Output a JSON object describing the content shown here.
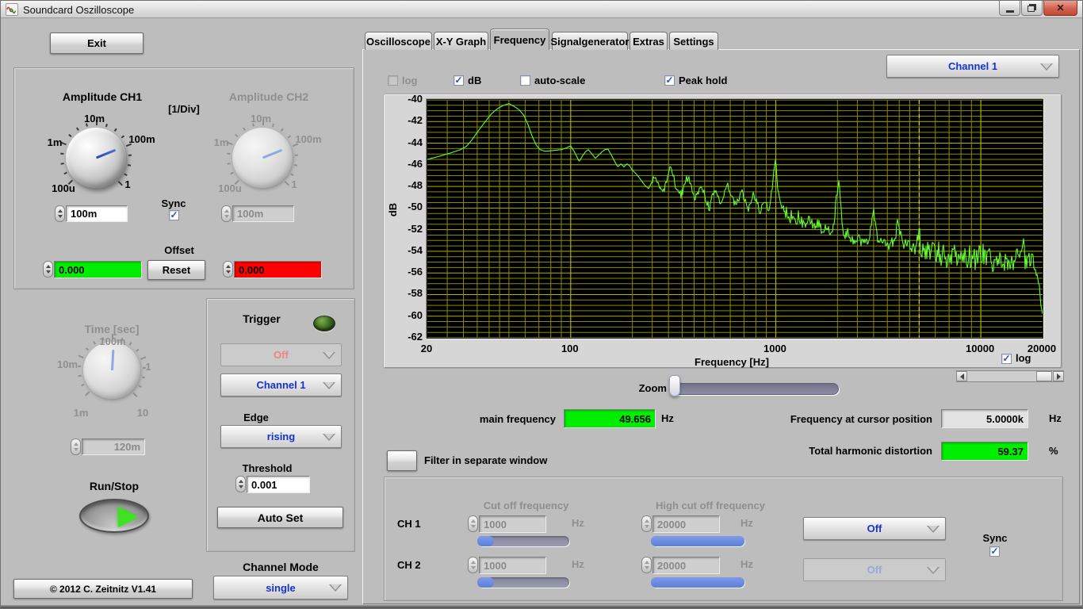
{
  "titlebar": {
    "title": "Soundcard Oszilloscope"
  },
  "left": {
    "exit": "Exit",
    "amp": {
      "ch1_title": "Amplitude CH1",
      "unit": "[1/Div]",
      "ch2_title": "Amplitude CH2",
      "ticks": [
        "100u",
        "1m",
        "10m",
        "100m",
        "1"
      ],
      "ch1_value": "100m",
      "ch2_value": "100m",
      "sync": "Sync",
      "sync_checked": true,
      "offset": "Offset",
      "reset": "Reset",
      "ch1_offset": "0.000",
      "ch2_offset": "0.000",
      "ch1_offset_color": "#00ef00",
      "ch2_offset_color": "#ff0000"
    },
    "time": {
      "title": "Time [sec]",
      "ticks": [
        "1m",
        "10m",
        "100m",
        "1",
        "10"
      ],
      "value": "120m"
    },
    "run_stop": "Run/Stop",
    "copyright": "© 2012   C. Zeitnitz V1.41"
  },
  "trigger": {
    "title": "Trigger",
    "mode": "Off",
    "source": "Channel 1",
    "edge_label": "Edge",
    "edge": "rising",
    "threshold_label": "Threshold",
    "threshold": "0.001",
    "auto_set": "Auto Set"
  },
  "channel_mode": {
    "label": "Channel Mode",
    "value": "single"
  },
  "tabs": {
    "items": [
      "Oscilloscope",
      "X-Y Graph",
      "Frequency",
      "Signalgenerator",
      "Extras",
      "Settings"
    ],
    "active": "Frequency"
  },
  "freq": {
    "log": "log",
    "log_checked": false,
    "db": "dB",
    "db_checked": true,
    "autoscale": "auto-scale",
    "autoscale_checked": false,
    "peak_hold": "Peak hold",
    "peak_hold_checked": true,
    "channel": "Channel 1",
    "axis_log": "log",
    "axis_log_checked": true,
    "zoom": "Zoom",
    "main_freq": {
      "label": "main frequency",
      "value": "49.656",
      "unit": "Hz"
    },
    "cursor_freq": {
      "label": "Frequency at cursor position",
      "value": "5.0000k",
      "unit": "Hz"
    },
    "thd": {
      "label": "Total harmonic distortion",
      "value": "59.37",
      "unit": "%"
    },
    "filter_window": "Filter in separate window",
    "filter": {
      "ch1": "CH 1",
      "ch2": "CH 2",
      "cutoff": "Cut off frequency",
      "high_cutoff": "High cut off frequency",
      "hz": "Hz",
      "ch1_cutoff": "1000",
      "ch2_cutoff": "1000",
      "ch1_high": "20000",
      "ch2_high": "20000",
      "ch1_mode": "Off",
      "ch2_mode": "Off",
      "sync": "Sync",
      "sync_checked": true
    }
  },
  "chart_data": {
    "type": "line",
    "title": "",
    "xlabel": "Frequency [Hz]",
    "ylabel": "dB",
    "xscale": "log",
    "xlim": [
      20,
      20000
    ],
    "ylim": [
      -62,
      -40
    ],
    "x_ticks": [
      20,
      100,
      1000,
      10000,
      20000
    ],
    "x_major": [
      100,
      1000,
      10000
    ],
    "y_ticks": [
      -40,
      -42,
      -44,
      -46,
      -48,
      -50,
      -52,
      -54,
      -56,
      -58,
      -60,
      -62
    ],
    "y_minor_step": 0.5,
    "cursor_hz": 5000,
    "main_frequency_hz": 49.656,
    "thd_percent": 59.37,
    "grid": true,
    "colors": {
      "trace": "#5fff2e",
      "grid": "#8a8a00",
      "grid_major": "#b0b000",
      "cursor": "#dede5a",
      "plot_bg": "#000000"
    },
    "seed": 123456789,
    "jitter_regions": [
      [
        250,
        1000,
        0.35
      ],
      [
        1000,
        5000,
        0.5
      ],
      [
        5000,
        19000,
        0.95
      ],
      [
        19000,
        20000,
        0.6
      ]
    ],
    "points": [
      [
        20,
        -45.5
      ],
      [
        23,
        -45.2
      ],
      [
        26,
        -44.9
      ],
      [
        29,
        -44.6
      ],
      [
        31,
        -44.3
      ],
      [
        33,
        -43.7
      ],
      [
        35,
        -43.0
      ],
      [
        38,
        -42.1
      ],
      [
        41,
        -41.3
      ],
      [
        44,
        -40.8
      ],
      [
        47,
        -40.5
      ],
      [
        50,
        -40.35
      ],
      [
        53,
        -40.6
      ],
      [
        56,
        -40.9
      ],
      [
        59,
        -41.4
      ],
      [
        62,
        -42.3
      ],
      [
        65,
        -43.4
      ],
      [
        68,
        -44.2
      ],
      [
        71,
        -44.6
      ],
      [
        75,
        -44.75
      ],
      [
        80,
        -44.7
      ],
      [
        85,
        -44.65
      ],
      [
        90,
        -44.6
      ],
      [
        95,
        -44.45
      ],
      [
        100,
        -44.25
      ],
      [
        105,
        -44.9
      ],
      [
        110,
        -45.7
      ],
      [
        114,
        -45.2
      ],
      [
        118,
        -44.8
      ],
      [
        122,
        -44.6
      ],
      [
        127,
        -45.0
      ],
      [
        132,
        -45.4
      ],
      [
        137,
        -45.1
      ],
      [
        142,
        -44.8
      ],
      [
        147,
        -44.6
      ],
      [
        152,
        -44.55
      ],
      [
        158,
        -45.1
      ],
      [
        164,
        -45.7
      ],
      [
        170,
        -46.2
      ],
      [
        176,
        -45.9
      ],
      [
        182,
        -46.2
      ],
      [
        188,
        -45.9
      ],
      [
        194,
        -46.1
      ],
      [
        200,
        -46.5
      ],
      [
        210,
        -46.9
      ],
      [
        220,
        -47.4
      ],
      [
        230,
        -47.9
      ],
      [
        240,
        -48.2
      ],
      [
        250,
        -47.5
      ],
      [
        258,
        -47.1
      ],
      [
        266,
        -47.6
      ],
      [
        275,
        -48.1
      ],
      [
        285,
        -48.4
      ],
      [
        295,
        -47.6
      ],
      [
        305,
        -46.1
      ],
      [
        315,
        -46.9
      ],
      [
        325,
        -47.9
      ],
      [
        335,
        -48.5
      ],
      [
        345,
        -48.8
      ],
      [
        355,
        -48.2
      ],
      [
        365,
        -47.4
      ],
      [
        375,
        -47.1
      ],
      [
        385,
        -47.9
      ],
      [
        395,
        -48.6
      ],
      [
        405,
        -49.2
      ],
      [
        415,
        -48.7
      ],
      [
        425,
        -48.1
      ],
      [
        435,
        -47.9
      ],
      [
        445,
        -48.5
      ],
      [
        455,
        -49.1
      ],
      [
        465,
        -49.6
      ],
      [
        475,
        -50.0
      ],
      [
        485,
        -49.3
      ],
      [
        495,
        -48.7
      ],
      [
        505,
        -48.2
      ],
      [
        520,
        -48.9
      ],
      [
        540,
        -49.5
      ],
      [
        560,
        -48.7
      ],
      [
        580,
        -47.9
      ],
      [
        600,
        -48.4
      ],
      [
        620,
        -49.2
      ],
      [
        640,
        -49.8
      ],
      [
        660,
        -49.1
      ],
      [
        680,
        -48.5
      ],
      [
        700,
        -49.0
      ],
      [
        720,
        -49.6
      ],
      [
        740,
        -50.1
      ],
      [
        760,
        -49.3
      ],
      [
        780,
        -48.7
      ],
      [
        800,
        -49.1
      ],
      [
        820,
        -49.8
      ],
      [
        840,
        -50.3
      ],
      [
        860,
        -49.8
      ],
      [
        880,
        -49.2
      ],
      [
        900,
        -49.7
      ],
      [
        920,
        -50.2
      ],
      [
        940,
        -49.4
      ],
      [
        960,
        -48.2
      ],
      [
        980,
        -46.5
      ],
      [
        1000,
        -45.7
      ],
      [
        1015,
        -47.2
      ],
      [
        1030,
        -48.6
      ],
      [
        1050,
        -49.7
      ],
      [
        1070,
        -50.4
      ],
      [
        1090,
        -49.9
      ],
      [
        1110,
        -50.7
      ],
      [
        1130,
        -50.2
      ],
      [
        1150,
        -50.8
      ],
      [
        1170,
        -51.2
      ],
      [
        1190,
        -50.6
      ],
      [
        1210,
        -51.0
      ],
      [
        1250,
        -51.4
      ],
      [
        1290,
        -50.7
      ],
      [
        1330,
        -51.2
      ],
      [
        1370,
        -51.7
      ],
      [
        1410,
        -51.1
      ],
      [
        1450,
        -50.7
      ],
      [
        1500,
        -51.4
      ],
      [
        1550,
        -51.9
      ],
      [
        1600,
        -51.3
      ],
      [
        1650,
        -51.8
      ],
      [
        1700,
        -52.2
      ],
      [
        1750,
        -51.6
      ],
      [
        1800,
        -52.0
      ],
      [
        1850,
        -52.4
      ],
      [
        1900,
        -51.8
      ],
      [
        1950,
        -50.2
      ],
      [
        2000,
        -48.1
      ],
      [
        2040,
        -47.3
      ],
      [
        2080,
        -49.6
      ],
      [
        2120,
        -51.8
      ],
      [
        2160,
        -52.5
      ],
      [
        2220,
        -52.2
      ],
      [
        2300,
        -52.6
      ],
      [
        2400,
        -53.0
      ],
      [
        2500,
        -52.6
      ],
      [
        2600,
        -53.1
      ],
      [
        2700,
        -52.8
      ],
      [
        2800,
        -53.3
      ],
      [
        2900,
        -51.9
      ],
      [
        3000,
        -49.9
      ],
      [
        3080,
        -51.8
      ],
      [
        3160,
        -53.2
      ],
      [
        3250,
        -52.7
      ],
      [
        3350,
        -53.4
      ],
      [
        3450,
        -53.0
      ],
      [
        3550,
        -53.5
      ],
      [
        3650,
        -52.9
      ],
      [
        3750,
        -53.3
      ],
      [
        3850,
        -52.4
      ],
      [
        3950,
        -51.1
      ],
      [
        4050,
        -52.3
      ],
      [
        4150,
        -53.5
      ],
      [
        4250,
        -53.1
      ],
      [
        4350,
        -53.7
      ],
      [
        4450,
        -53.2
      ],
      [
        4550,
        -53.8
      ],
      [
        4650,
        -53.3
      ],
      [
        4750,
        -53.9
      ],
      [
        4850,
        -53.4
      ],
      [
        4950,
        -52.6
      ],
      [
        5000,
        -52.2
      ],
      [
        5100,
        -53.5
      ],
      [
        5250,
        -53.9
      ],
      [
        5400,
        -54.2
      ],
      [
        5550,
        -53.7
      ],
      [
        5700,
        -54.3
      ],
      [
        5850,
        -53.9
      ],
      [
        6000,
        -54.4
      ],
      [
        6200,
        -53.8
      ],
      [
        6400,
        -54.5
      ],
      [
        6600,
        -54.0
      ],
      [
        6800,
        -54.6
      ],
      [
        7000,
        -54.1
      ],
      [
        7200,
        -54.6
      ],
      [
        7400,
        -54.0
      ],
      [
        7600,
        -54.7
      ],
      [
        7800,
        -54.2
      ],
      [
        8000,
        -53.8
      ],
      [
        8200,
        -54.6
      ],
      [
        8400,
        -54.1
      ],
      [
        8600,
        -54.8
      ],
      [
        8800,
        -54.3
      ],
      [
        9000,
        -54.9
      ],
      [
        9200,
        -54.4
      ],
      [
        9400,
        -55.0
      ],
      [
        9600,
        -54.5
      ],
      [
        9800,
        -54.1
      ],
      [
        10000,
        -54.6
      ],
      [
        10300,
        -54.2
      ],
      [
        10600,
        -54.9
      ],
      [
        11000,
        -54.4
      ],
      [
        11400,
        -55.1
      ],
      [
        11800,
        -54.6
      ],
      [
        12200,
        -55.2
      ],
      [
        12600,
        -54.7
      ],
      [
        13000,
        -55.3
      ],
      [
        13400,
        -54.8
      ],
      [
        13800,
        -55.4
      ],
      [
        14200,
        -54.9
      ],
      [
        14600,
        -55.3
      ],
      [
        15000,
        -54.5
      ],
      [
        15400,
        -55.1
      ],
      [
        15800,
        -53.7
      ],
      [
        16100,
        -52.8
      ],
      [
        16400,
        -54.6
      ],
      [
        16700,
        -55.2
      ],
      [
        17000,
        -54.7
      ],
      [
        17400,
        -55.4
      ],
      [
        17800,
        -55.0
      ],
      [
        18200,
        -55.6
      ],
      [
        18600,
        -56.1
      ],
      [
        19000,
        -56.6
      ],
      [
        19200,
        -57.2
      ],
      [
        19400,
        -57.9
      ],
      [
        19600,
        -58.6
      ],
      [
        19800,
        -59.2
      ],
      [
        20000,
        -59.8
      ]
    ]
  }
}
